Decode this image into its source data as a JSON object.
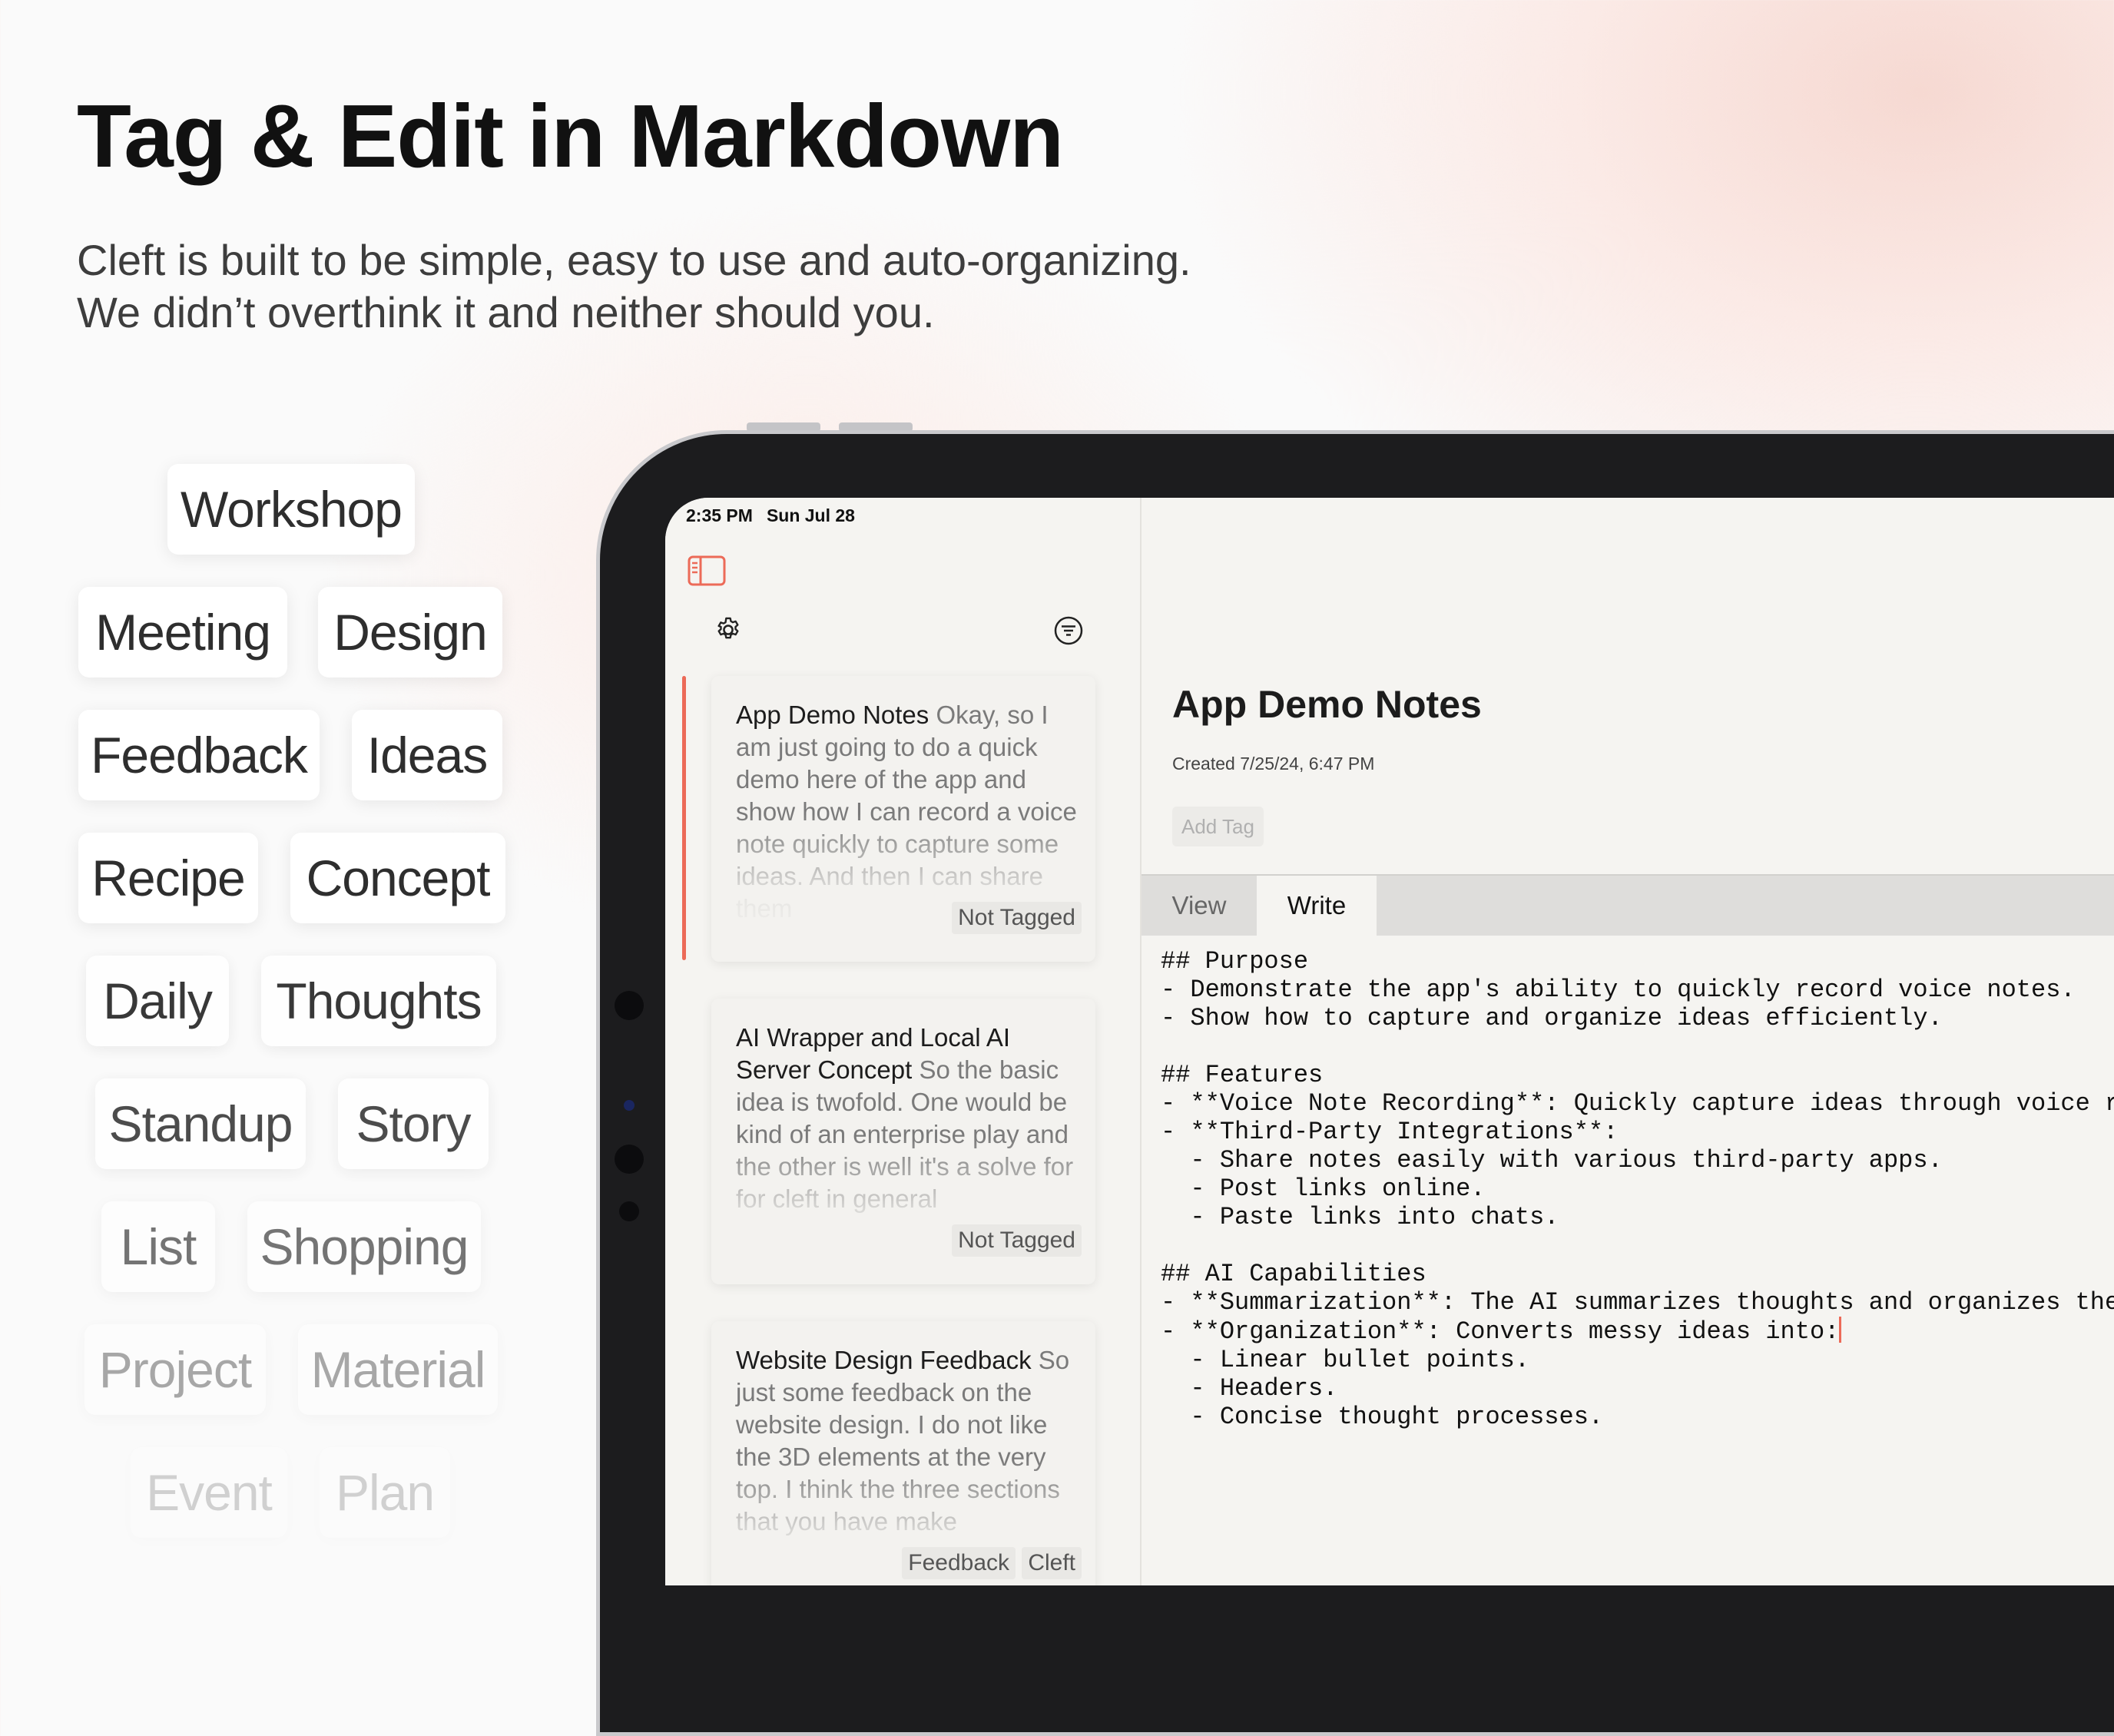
{
  "headline": "Tag & Edit in Markdown",
  "subtitle": {
    "line1": "Cleft is built to be simple, easy to use and auto-organizing.",
    "line2": "We didn’t overthink it and neither should you."
  },
  "tags": [
    "Workshop",
    "Meeting",
    "Design",
    "Feedback",
    "Ideas",
    "Recipe",
    "Concept",
    "Daily",
    "Thoughts",
    "Standup",
    "Story",
    "List",
    "Shopping",
    "Project",
    "Material",
    "Event",
    "Plan"
  ],
  "status_bar": {
    "time": "2:35 PM",
    "date": "Sun Jul 28"
  },
  "icons": {
    "sidebar_toggle": "sidebar-icon",
    "settings": "gear-icon",
    "filter": "filter-icon"
  },
  "accent_color": "#ec6a58",
  "notes": [
    {
      "title": "App Demo Notes",
      "preview": "Okay, so I am just going to do a quick demo here of the app and show how I can record a voice note quickly to capture some ideas. And then I can share them",
      "tags": [
        "Not Tagged"
      ]
    },
    {
      "title": "AI Wrapper and Local AI Server Concept",
      "preview": "So the basic idea is twofold. One would be kind of an enterprise play and the other is well it's a solve for for cleft in general",
      "tags": [
        "Not Tagged"
      ]
    },
    {
      "title": "Website Design Feedback",
      "preview": "So just some feedback on the website design. I do not like the 3D elements at the very top. I think the three sections that you have make",
      "tags": [
        "Feedback",
        "Cleft"
      ]
    }
  ],
  "detail": {
    "title": "App Demo Notes",
    "created": "Created 7/25/24, 6:47 PM",
    "add_tag": "Add Tag",
    "tabs": [
      "View",
      "Write"
    ],
    "active_tab": "Write",
    "lines": [
      "## Purpose",
      "- Demonstrate the app's ability to quickly record voice notes.",
      "- Show how to capture and organize ideas efficiently.",
      "",
      "## Features",
      "- **Voice Note Recording**: Quickly capture ideas through voice r",
      "- **Third-Party Integrations**:",
      "  - Share notes easily with various third-party apps.",
      "  - Post links online.",
      "  - Paste links into chats.",
      "",
      "## AI Capabilities",
      "- **Summarization**: The AI summarizes thoughts and organizes the",
      "- **Organization**: Converts messy ideas into:",
      "  - Linear bullet points.",
      "  - Headers.",
      "  - Concise thought processes."
    ]
  }
}
